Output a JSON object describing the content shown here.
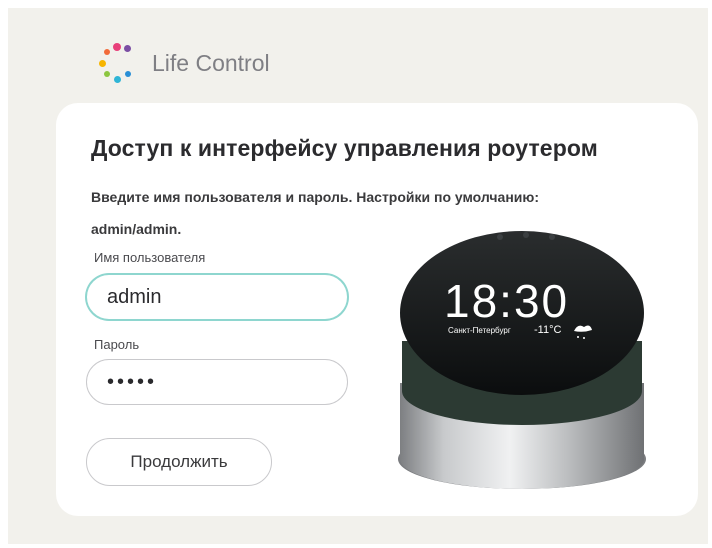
{
  "brand": {
    "name": "Life Control"
  },
  "login": {
    "title": "Доступ к интерфейсу управления роутером",
    "subtitle": "Введите имя пользователя и пароль. Настройки по умолчанию: admin/admin.",
    "username_label": "Имя пользователя",
    "username_value": "admin",
    "password_label": "Пароль",
    "password_value": "•••••",
    "submit_label": "Продолжить"
  },
  "device": {
    "time": "18:30",
    "city": "Санкт-Петербург",
    "temperature": "-11°C"
  },
  "colors": {
    "background": "#f2f1ec",
    "focus_border": "#8ed6cf",
    "logo_dots": [
      "#f26b3a",
      "#f7b500",
      "#8cc63f",
      "#2fb5d6",
      "#7b4ea3",
      "#e8407a"
    ]
  }
}
